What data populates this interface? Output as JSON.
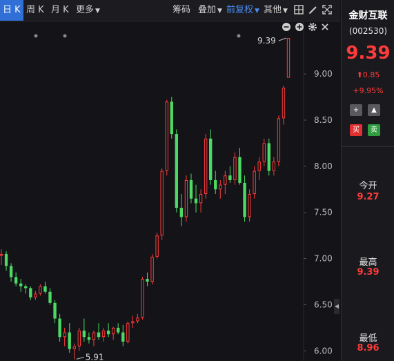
{
  "toolbar": {
    "periods": [
      "日 K",
      "周 K",
      "月 K"
    ],
    "more": "更多",
    "chips": "筹码",
    "overlay": "叠加",
    "adjust": "前复权",
    "other": "其他"
  },
  "sidebar": {
    "name": "金财互联",
    "code": "(002530)",
    "price": "9.39",
    "change": "0.85",
    "change_pct": "+9.95%",
    "buy": "买",
    "sell": "卖",
    "open_label": "今开",
    "open_value": "9.27",
    "high_label": "最高",
    "high_value": "9.39",
    "low_label": "最低",
    "low_value": "8.96"
  },
  "colors": {
    "up": "#ff3b3b",
    "down": "#4cd964",
    "accent": "#2f6fd6"
  },
  "icons": [
    "grid-icon",
    "pen-icon",
    "expand-icon",
    "minus-icon",
    "plus-icon",
    "gear-icon",
    "close-icon"
  ],
  "chart_data": {
    "type": "candlestick",
    "y_ticks": [
      "9.00",
      "8.50",
      "8.00",
      "7.50",
      "7.00",
      "6.50",
      "6.00"
    ],
    "ylim": [
      5.95,
      9.45
    ],
    "max_label": "9.39",
    "min_label": "5.91",
    "candles": [
      [
        7.03,
        7.1,
        6.93,
        7.05
      ],
      [
        7.05,
        7.08,
        6.87,
        6.92
      ],
      [
        6.92,
        6.95,
        6.75,
        6.8
      ],
      [
        6.8,
        6.85,
        6.7,
        6.73
      ],
      [
        6.73,
        6.78,
        6.64,
        6.7
      ],
      [
        6.7,
        6.72,
        6.62,
        6.68
      ],
      [
        6.68,
        6.7,
        6.55,
        6.58
      ],
      [
        6.58,
        6.65,
        6.55,
        6.62
      ],
      [
        6.62,
        6.72,
        6.6,
        6.7
      ],
      [
        6.7,
        6.75,
        6.62,
        6.64
      ],
      [
        6.64,
        6.68,
        6.5,
        6.52
      ],
      [
        6.52,
        6.55,
        6.3,
        6.35
      ],
      [
        6.35,
        6.4,
        6.1,
        6.15
      ],
      [
        6.15,
        6.25,
        6.05,
        6.2
      ],
      [
        6.2,
        6.3,
        5.98,
        6.02
      ],
      [
        6.02,
        6.08,
        5.91,
        6.05
      ],
      [
        6.05,
        6.25,
        6.0,
        6.22
      ],
      [
        6.22,
        6.35,
        6.1,
        6.15
      ],
      [
        6.15,
        6.2,
        6.08,
        6.12
      ],
      [
        6.12,
        6.22,
        6.05,
        6.2
      ],
      [
        6.2,
        6.3,
        6.12,
        6.15
      ],
      [
        6.15,
        6.25,
        6.1,
        6.22
      ],
      [
        6.22,
        6.3,
        6.15,
        6.18
      ],
      [
        6.18,
        6.26,
        6.12,
        6.25
      ],
      [
        6.25,
        6.3,
        6.18,
        6.2
      ],
      [
        6.2,
        6.28,
        6.05,
        6.1
      ],
      [
        6.1,
        6.32,
        6.08,
        6.3
      ],
      [
        6.3,
        6.38,
        6.25,
        6.32
      ],
      [
        6.32,
        6.4,
        6.3,
        6.36
      ],
      [
        6.36,
        6.8,
        6.34,
        6.78
      ],
      [
        6.78,
        6.85,
        6.7,
        6.75
      ],
      [
        6.75,
        7.05,
        6.72,
        7.02
      ],
      [
        7.02,
        7.28,
        7.0,
        7.25
      ],
      [
        7.25,
        7.98,
        7.2,
        7.95
      ],
      [
        7.95,
        8.72,
        7.9,
        8.7
      ],
      [
        8.7,
        8.75,
        8.3,
        8.35
      ],
      [
        8.35,
        8.4,
        7.5,
        7.55
      ],
      [
        7.55,
        7.7,
        7.35,
        7.45
      ],
      [
        7.45,
        7.9,
        7.4,
        7.85
      ],
      [
        7.85,
        7.92,
        7.6,
        7.65
      ],
      [
        7.65,
        7.8,
        7.5,
        7.6
      ],
      [
        7.6,
        7.75,
        7.5,
        7.7
      ],
      [
        7.7,
        8.35,
        7.65,
        8.3
      ],
      [
        8.3,
        8.4,
        7.8,
        7.85
      ],
      [
        7.85,
        7.95,
        7.7,
        7.75
      ],
      [
        7.75,
        7.85,
        7.65,
        7.8
      ],
      [
        7.8,
        7.95,
        7.7,
        7.9
      ],
      [
        7.9,
        8.0,
        7.82,
        7.85
      ],
      [
        7.85,
        8.15,
        7.8,
        8.1
      ],
      [
        8.1,
        8.2,
        7.8,
        7.82
      ],
      [
        7.82,
        7.9,
        7.4,
        7.45
      ],
      [
        7.45,
        7.75,
        7.4,
        7.7
      ],
      [
        7.7,
        8.0,
        7.65,
        7.95
      ],
      [
        7.95,
        8.1,
        7.85,
        8.05
      ],
      [
        8.05,
        8.3,
        8.0,
        8.25
      ],
      [
        8.25,
        8.3,
        7.9,
        7.95
      ],
      [
        7.95,
        8.1,
        7.9,
        8.05
      ],
      [
        8.05,
        8.55,
        8.0,
        8.52
      ],
      [
        8.52,
        8.87,
        8.45,
        8.85
      ],
      [
        8.96,
        9.39,
        8.96,
        9.39
      ]
    ]
  }
}
